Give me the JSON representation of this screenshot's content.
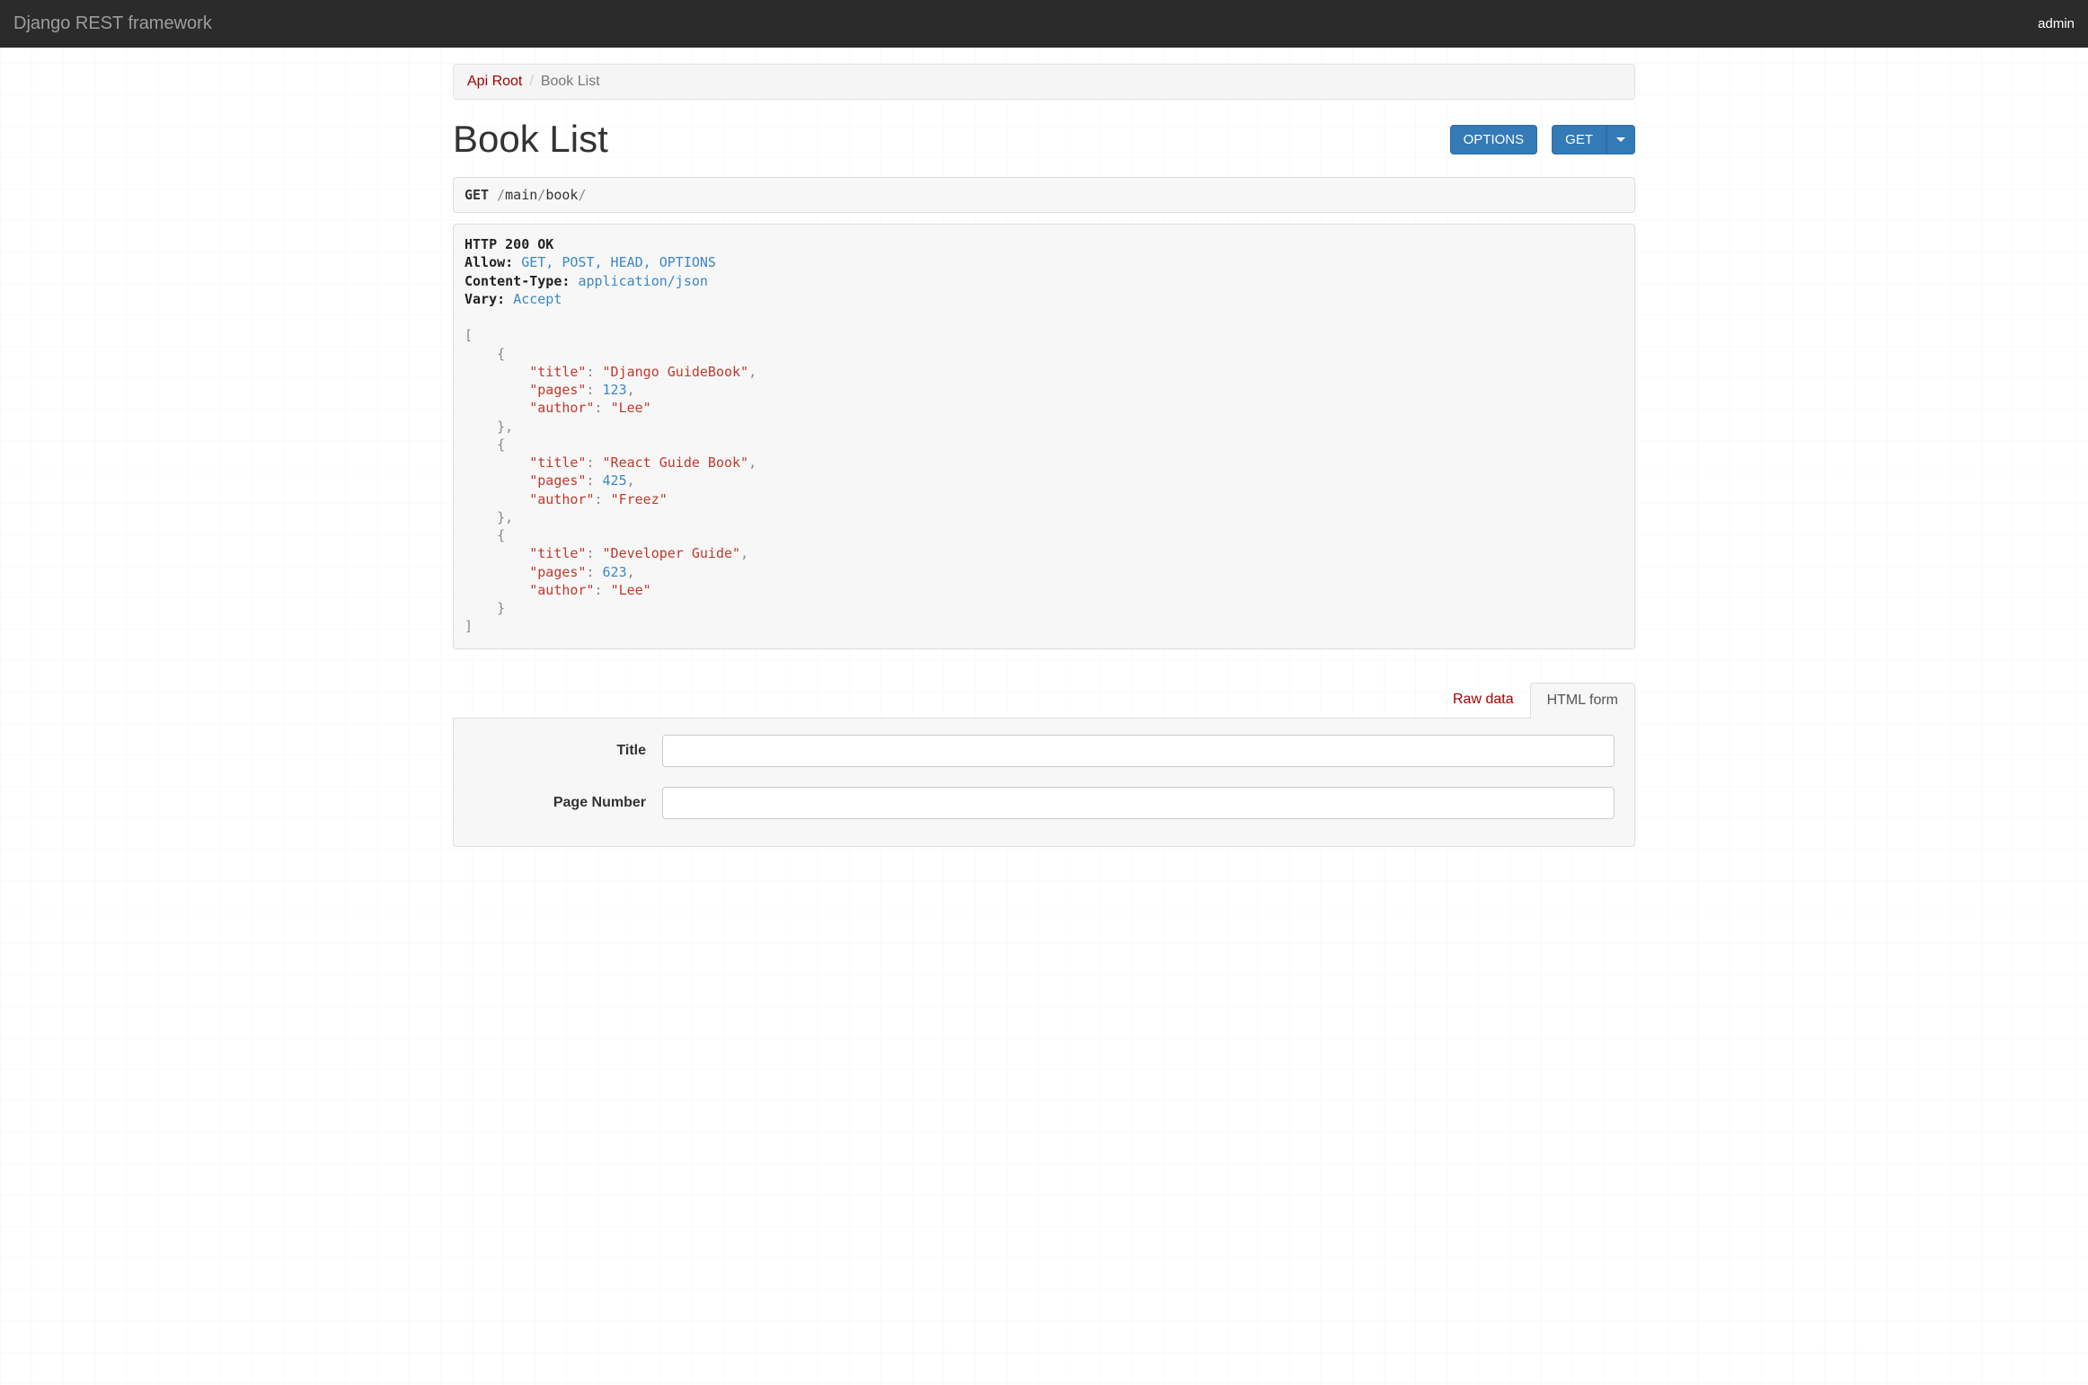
{
  "navbar": {
    "brand": "Django REST framework",
    "user": "admin"
  },
  "breadcrumb": {
    "root_label": "Api Root",
    "separator": "/",
    "current": "Book List"
  },
  "page": {
    "title": "Book List",
    "options_button": "OPTIONS",
    "get_button": "GET"
  },
  "request": {
    "method": "GET",
    "path_prefix": "/",
    "path_seg1": "main",
    "path_sep": "/",
    "path_seg2": "book",
    "path_trailing": "/"
  },
  "response": {
    "status_line": "HTTP 200 OK",
    "headers": {
      "allow_label": "Allow:",
      "allow_value": "GET, POST, HEAD, OPTIONS",
      "content_type_label": "Content-Type:",
      "content_type_value": "application/json",
      "vary_label": "Vary:",
      "vary_value": "Accept"
    },
    "json_items": [
      {
        "title": "Django GuideBook",
        "pages": 123,
        "author": "Lee"
      },
      {
        "title": "React Guide Book",
        "pages": 425,
        "author": "Freez"
      },
      {
        "title": "Developer Guide",
        "pages": 623,
        "author": "Lee"
      }
    ]
  },
  "tabs": {
    "raw": "Raw data",
    "html": "HTML form"
  },
  "form": {
    "title_label": "Title",
    "pages_label": "Page Number"
  }
}
